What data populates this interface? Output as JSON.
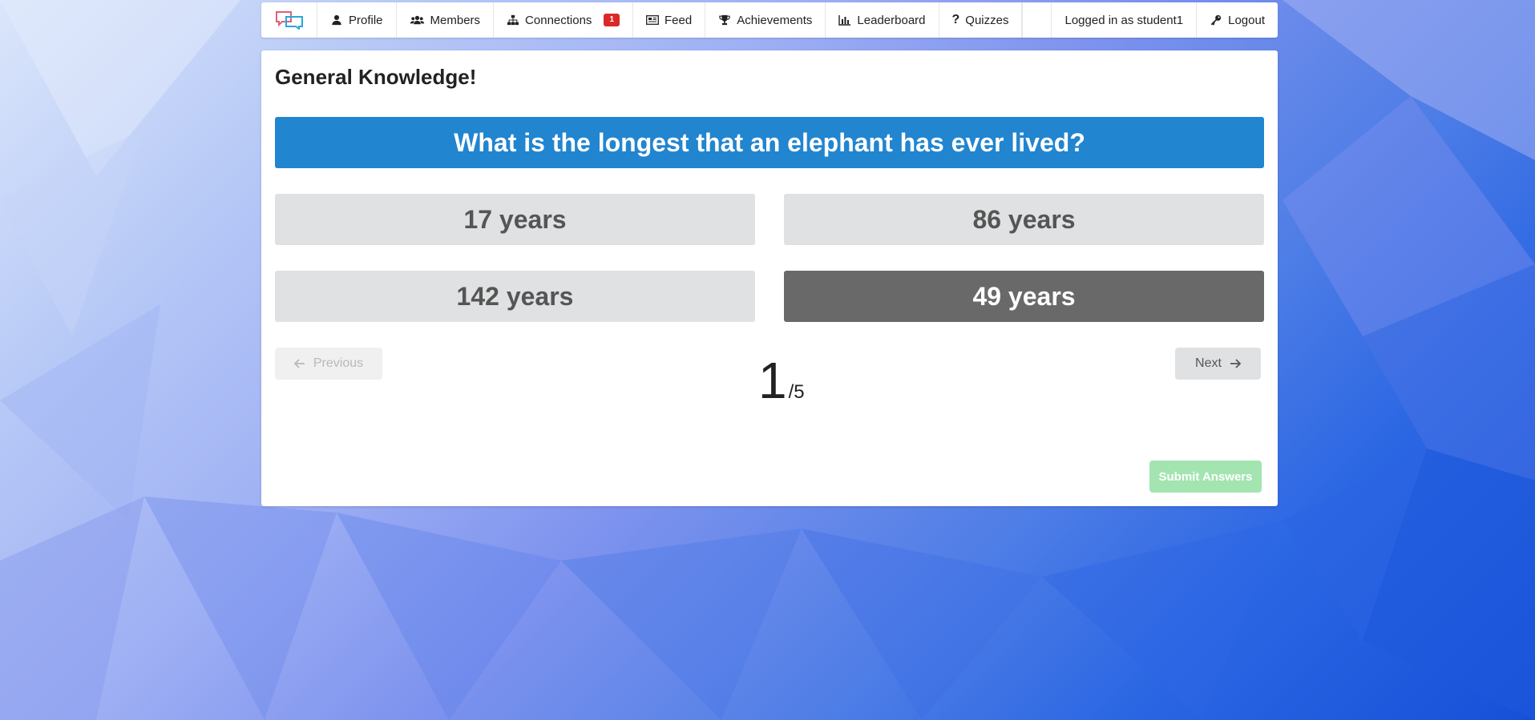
{
  "nav": {
    "items": [
      {
        "label": "Profile",
        "icon": "user-icon"
      },
      {
        "label": "Members",
        "icon": "users-icon"
      },
      {
        "label": "Connections",
        "icon": "sitemap-icon",
        "badge": "1"
      },
      {
        "label": "Feed",
        "icon": "newspaper-icon"
      },
      {
        "label": "Achievements",
        "icon": "trophy-icon"
      },
      {
        "label": "Leaderboard",
        "icon": "bar-chart-icon"
      },
      {
        "label": "Quizzes",
        "icon": "question-icon"
      }
    ],
    "logged_in": "Logged in as student1",
    "logout": "Logout"
  },
  "quiz": {
    "title": "General Knowledge!",
    "question": "What is the longest that an elephant has ever lived?",
    "answers": [
      "17 years",
      "86 years",
      "142 years",
      "49 years"
    ],
    "selected_answer": "49 years",
    "current": "1",
    "total": "/5",
    "previous_label": "Previous",
    "next_label": "Next",
    "submit_label": "Submit Answers"
  },
  "colors": {
    "question_bg": "#2185d0",
    "answer_bg": "#e0e1e2",
    "selected_bg": "#696969",
    "badge_bg": "#db2828",
    "submit_bg": "#a3e4b1"
  }
}
